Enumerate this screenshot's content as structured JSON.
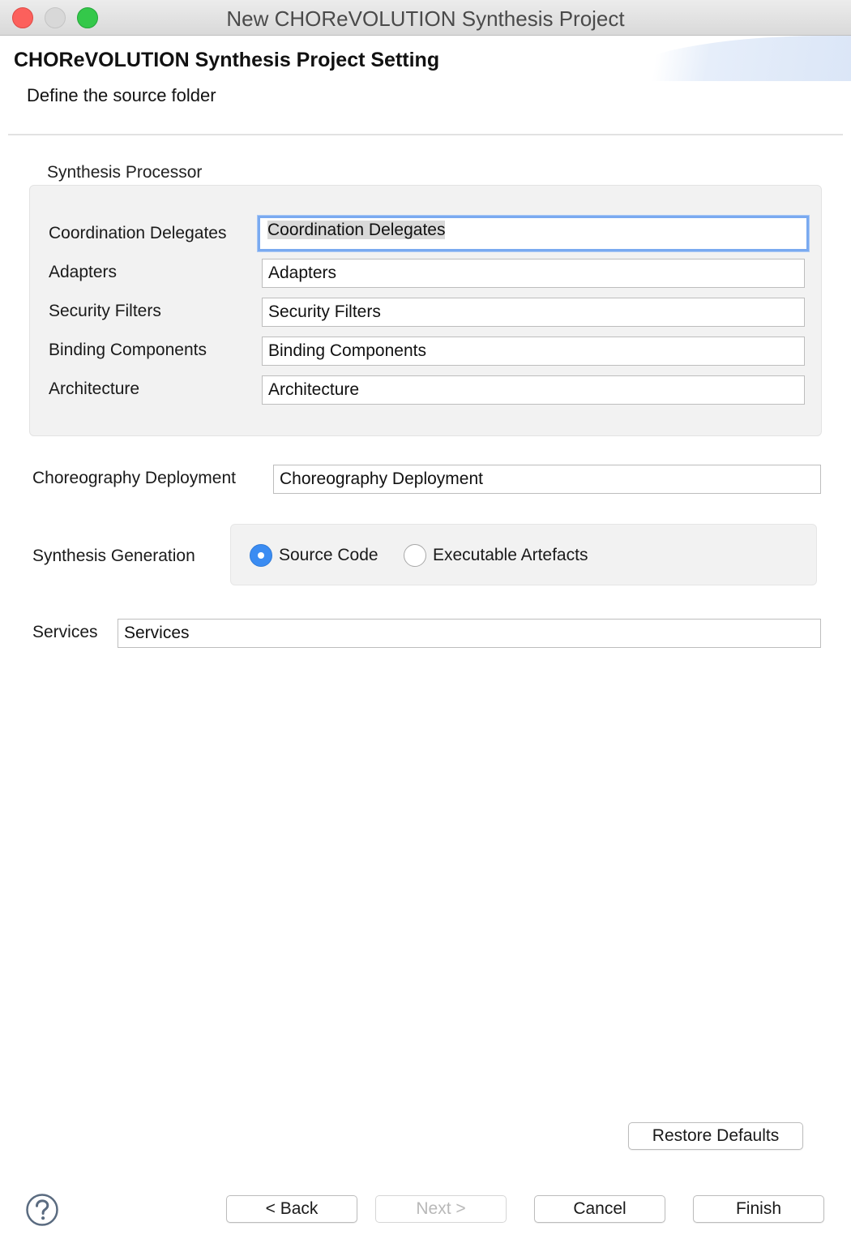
{
  "window": {
    "title": "New CHOReVOLUTION Synthesis Project"
  },
  "header": {
    "title": "CHOReVOLUTION Synthesis Project Setting",
    "description": "Define the source folder"
  },
  "synthesis_processor": {
    "group_label": "Synthesis Processor",
    "fields": [
      {
        "label": "Coordination Delegates",
        "value": "Coordination Delegates"
      },
      {
        "label": "Adapters",
        "value": "Adapters"
      },
      {
        "label": "Security Filters",
        "value": "Security Filters"
      },
      {
        "label": "Binding Components",
        "value": "Binding Components"
      },
      {
        "label": "Architecture",
        "value": "Architecture"
      }
    ]
  },
  "choreography_deployment": {
    "label": "Choreography Deployment",
    "value": "Choreography Deployment"
  },
  "synthesis_generation": {
    "label": "Synthesis Generation",
    "options": [
      {
        "label": "Source Code",
        "selected": true
      },
      {
        "label": "Executable Artefacts",
        "selected": false
      }
    ]
  },
  "services": {
    "label": "Services",
    "value": "Services"
  },
  "buttons": {
    "restore_defaults": "Restore Defaults",
    "back": "< Back",
    "next": "Next >",
    "cancel": "Cancel",
    "finish": "Finish"
  },
  "icons": {
    "help": "help-icon"
  },
  "colors": {
    "accent": "#3b8cf2",
    "focus_ring": "#7aaaf0"
  }
}
